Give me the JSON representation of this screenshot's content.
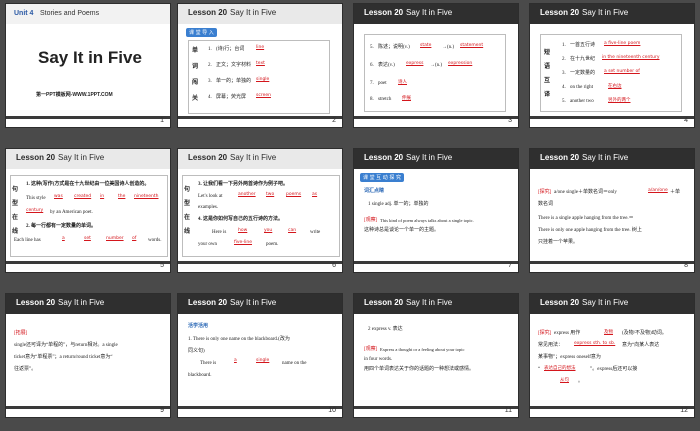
{
  "slides": [
    {
      "num": "1",
      "unit": "Unit 4",
      "unit_sub": "Stories and Poems",
      "title": "Say It in Five",
      "footer": "第一PPT模板网-WWW.1PPT.COM"
    },
    {
      "num": "2",
      "lesson": "Lesson  20",
      "title": "Say It in Five",
      "tag": "课 堂 导 入",
      "side": [
        "单",
        "词",
        "闯",
        "关"
      ],
      "items": [
        {
          "n": "1.",
          "cn": "(诗)行；台词",
          "ans": "line"
        },
        {
          "n": "2.",
          "cn": "正文；文字材料",
          "ans": "text"
        },
        {
          "n": "3.",
          "cn": "单一的；单独的",
          "ans": "single"
        },
        {
          "n": "4.",
          "cn": "屏幕；荧光屏",
          "ans": "screen"
        }
      ]
    },
    {
      "num": "3",
      "lesson": "Lesson  20",
      "title": "Say It in Five",
      "items": [
        {
          "n": "5.",
          "cn": "陈述；说明(v.)",
          "ans": "state",
          "mid": "→(n.)",
          "ans2": "statement"
        },
        {
          "n": "6.",
          "cn": "表达(v.)",
          "ans": "express",
          "mid": "→(n.)",
          "ans2": "expression"
        },
        {
          "n": "7.",
          "cn": "poet",
          "ans": "诗人"
        },
        {
          "n": "8.",
          "cn": "stretch",
          "ans": "伸展"
        }
      ]
    },
    {
      "num": "4",
      "lesson": "Lesson  20",
      "title": "Say It in Five",
      "side": [
        "短",
        "语",
        "互",
        "译"
      ],
      "items": [
        {
          "n": "1.",
          "cn": "一首五行诗",
          "ans": "a five-line poem"
        },
        {
          "n": "2.",
          "cn": "在十九世纪",
          "ans": "in the nineteenth century"
        },
        {
          "n": "3.",
          "cn": "一定数量的",
          "ans": "a set number of"
        },
        {
          "n": "4.",
          "cn": "on the right",
          "ans": "在右边"
        },
        {
          "n": "5.",
          "cn": "another two",
          "ans": "另外的两个"
        }
      ]
    },
    {
      "num": "5",
      "lesson": "Lesson  20",
      "title": "Say It in Five",
      "side": [
        "句",
        "型",
        "在",
        "线"
      ],
      "l1": "1.  这种(写作)方式是在十九世纪由一位美国诗人创造的。",
      "l2a": "This style",
      "b1": "was",
      "b2": "created",
      "b3": "in",
      "b4": "the",
      "b5": "nineteenth",
      "l3a": "century",
      "l3b": "by an American poet.",
      "l4": "2.  每一行都有一定数量的单词。",
      "l5a": "Each line has",
      "b6": "a",
      "b7": "set",
      "b8": "number",
      "b9": "of",
      "l5b": "words."
    },
    {
      "num": "6",
      "lesson": "Lesson  20",
      "title": "Say It in Five",
      "side": [
        "句",
        "型",
        "在",
        "线"
      ],
      "l1": "3.  让我们看一下另外两首诗作为例子吧。",
      "l2a": "Let's look at",
      "b1": "another",
      "b2": "two",
      "b3": "poems",
      "b4": "as",
      "l3": "examples.",
      "l4": "4.  这是你如何写自己的五行诗的方法。",
      "l5a": "Here is",
      "b5": "how",
      "b6": "you",
      "b7": "can",
      "l5b": "write",
      "l6a": "your own",
      "b8": "five-line",
      "l6b": "poem."
    },
    {
      "num": "7",
      "lesson": "Lesson  20",
      "title": "Say It in Five",
      "tag": "课 堂 互 动 探 究",
      "h": "词汇点睛",
      "l1": "1     single  adj.  单一的；单独的",
      "l2a": "[观察]",
      "l2b": "This kind of poem always talks about a single topic.",
      "l3": "这种诗总是谈论一个单一的主题。"
    },
    {
      "num": "8",
      "lesson": "Lesson  20",
      "title": "Say It in Five",
      "l1a": "[探究]",
      "l1b": "a/one single＋单数名词＝only",
      "ans": "a/an/one",
      "l1c": "＋单",
      "l2": "数名词",
      "l3": "There is a single apple hanging from the tree.＝",
      "l4": "There is only one apple hanging from the tree. 树上",
      "l5": "只挂着一个苹果。"
    },
    {
      "num": "9",
      "lesson": "Lesson  20",
      "title": "Say It in Five",
      "l1a": "[拓展]",
      "l2": "single还可译为“单程的”，与return相对。a single",
      "l3": "ticket意为“单程票”；a return/round ticket意为“",
      "l4": "往返票”。"
    },
    {
      "num": "10",
      "lesson": "Lesson  20",
      "title": "Say It in Five",
      "h": "活学活用",
      "l1": "1.   There is only one name on the blackboard.(改为",
      "l2": "同义句)",
      "l3a": "There is",
      "ans1": "a",
      "ans2": "single",
      "l3b": "name on the",
      "l4": "blackboard."
    },
    {
      "num": "11",
      "lesson": "Lesson  20",
      "title": "Say It in Five",
      "l1": "2     express  v.  表达",
      "l2a": "[观察]",
      "l2b": "Express a thought or a feeling about your topic",
      "l3": "in four words.",
      "l4": "用四个单词表达关于你的话题的一种想法或感情。"
    },
    {
      "num": "12",
      "lesson": "Lesson  20",
      "title": "Say It in Five",
      "l1a": "[探究]",
      "l1b": "express 用作",
      "ans1": "及物",
      "l1c": "(及物/不及物)动词。",
      "l2a": "常见用法：",
      "ans2": "express sth. to sb.",
      "l2b": "意为“向某人表达",
      "l3": "某事物”；express oneself意为",
      "l4a": "“",
      "ans3": "表达自己的想法",
      "l4b": "”。express后还可以接",
      "ans4": "从句",
      "l5": "。"
    }
  ]
}
